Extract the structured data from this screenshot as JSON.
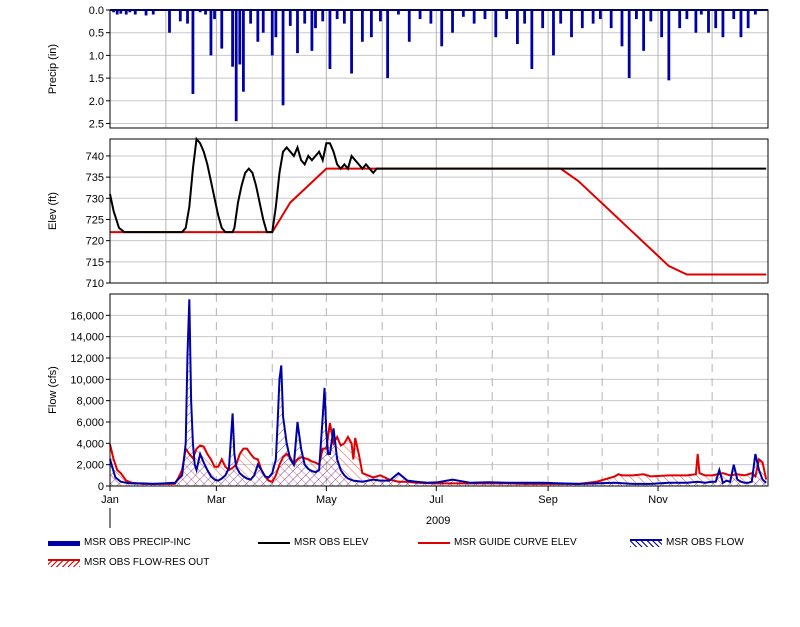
{
  "colors": {
    "precip": "#0000A8",
    "elev": "#000000",
    "guide": "#E00000",
    "flow": "#0000A8",
    "flow_res_out": "#E00000",
    "grid": "#C8C8C8",
    "month_grid": "#B4B4B4"
  },
  "chart_data": [
    {
      "type": "bar",
      "ylabel": "Precip (in)",
      "inverted_y": true,
      "ylim": [
        0,
        2.6
      ],
      "yticks": [
        0.0,
        0.5,
        1.0,
        1.5,
        2.0,
        2.5
      ],
      "ytick_labels": [
        "0.0",
        "0.5",
        "1.0",
        "1.5",
        "2.0",
        "2.5"
      ],
      "series": [
        {
          "name": "MSR OBS PRECIP-INC",
          "x_day": [
            2,
            4,
            6,
            9,
            11,
            14,
            20,
            24,
            33,
            39,
            43,
            46,
            50,
            53,
            56,
            58,
            62,
            68,
            70,
            72,
            74,
            78,
            82,
            85,
            90,
            92,
            96,
            100,
            104,
            108,
            112,
            114,
            118,
            122,
            126,
            130,
            134,
            140,
            145,
            150,
            154,
            160,
            166,
            172,
            178,
            184,
            190,
            196,
            202,
            208,
            214,
            220,
            226,
            230,
            234,
            240,
            246,
            250,
            256,
            262,
            268,
            272,
            278,
            284,
            288,
            292,
            296,
            300,
            306,
            310,
            316,
            320,
            325,
            328,
            332,
            336,
            340,
            346,
            350,
            354,
            358
          ],
          "values": [
            0.05,
            0.1,
            0.08,
            0.1,
            0.05,
            0.1,
            0.12,
            0.1,
            0.5,
            0.25,
            0.3,
            1.85,
            0.05,
            0.1,
            1.0,
            0.2,
            0.85,
            1.25,
            2.45,
            1.2,
            1.8,
            0.3,
            0.7,
            0.5,
            1.0,
            0.6,
            2.1,
            0.35,
            0.95,
            0.3,
            0.9,
            0.4,
            0.25,
            1.3,
            0.2,
            0.3,
            1.4,
            0.7,
            0.6,
            0.25,
            1.5,
            0.1,
            0.7,
            0.2,
            0.3,
            0.8,
            0.5,
            0.15,
            0.3,
            0.2,
            0.6,
            0.2,
            0.75,
            0.3,
            1.3,
            0.4,
            1.0,
            0.3,
            0.6,
            0.4,
            0.3,
            0.2,
            0.4,
            0.8,
            1.5,
            0.2,
            0.9,
            0.25,
            0.6,
            1.55,
            0.4,
            0.2,
            0.5,
            0.1,
            0.5,
            0.4,
            0.6,
            0.2,
            0.6,
            0.4,
            0.1
          ]
        }
      ]
    },
    {
      "type": "line",
      "ylabel": "Elev (ft)",
      "ylim": [
        710,
        744
      ],
      "yticks": [
        710,
        715,
        720,
        725,
        730,
        735,
        740
      ],
      "ytick_labels": [
        "710",
        "715",
        "720",
        "725",
        "730",
        "735",
        "740"
      ],
      "series": [
        {
          "name": "MSR OBS ELEV",
          "x_day": [
            0,
            2,
            5,
            8,
            20,
            30,
            35,
            40,
            42,
            44,
            46,
            48,
            50,
            52,
            54,
            56,
            58,
            60,
            62,
            64,
            66,
            68,
            69,
            71,
            73,
            75,
            77,
            79,
            81,
            83,
            85,
            87,
            88,
            90,
            92,
            94,
            96,
            98,
            100,
            102,
            104,
            106,
            108,
            110,
            112,
            114,
            116,
            118,
            120,
            122,
            124,
            126,
            128,
            130,
            132,
            134,
            136,
            138,
            140,
            142,
            144,
            146,
            148,
            150,
            155,
            160,
            170,
            180,
            190,
            200,
            210,
            220,
            230,
            240,
            250,
            255,
            258,
            260,
            263,
            266,
            268,
            270,
            272,
            274,
            278,
            282,
            286,
            290,
            294,
            298,
            302,
            306,
            310,
            314,
            318,
            322,
            326,
            328,
            330,
            332,
            334,
            336,
            338,
            340,
            342,
            344,
            346,
            348,
            350,
            352,
            354,
            355,
            356,
            357,
            358,
            360,
            362,
            364
          ],
          "values": [
            731,
            727,
            723,
            722,
            722,
            722,
            722,
            722,
            723,
            728,
            737,
            744,
            743,
            741,
            738,
            734,
            730,
            726,
            723,
            722,
            722,
            722,
            723,
            729,
            733,
            736,
            737,
            736,
            733,
            729,
            725,
            722,
            722,
            722,
            728,
            736,
            741,
            742,
            741,
            740,
            742,
            739,
            738,
            740,
            739,
            740,
            741,
            739,
            743,
            743,
            741,
            738,
            737,
            738,
            737,
            740,
            739,
            738,
            737,
            738,
            737,
            736,
            737,
            737,
            737,
            737,
            737,
            737,
            737,
            737,
            737,
            737,
            737,
            737,
            737,
            737,
            737,
            737,
            737,
            737,
            737,
            737,
            737,
            737,
            737,
            737,
            737,
            737,
            737,
            737,
            737,
            737,
            737,
            737,
            737,
            737,
            737,
            737,
            737,
            737,
            737,
            737,
            737,
            737,
            737,
            737,
            737,
            737,
            737,
            737,
            737,
            737,
            737,
            737,
            737,
            737,
            737,
            737,
            737
          ]
        },
        {
          "name": "MSR GUIDE CURVE ELEV",
          "x_day": [
            0,
            10,
            30,
            50,
            70,
            80,
            90,
            100,
            110,
            120,
            140,
            160,
            180,
            200,
            220,
            240,
            250,
            260,
            270,
            280,
            290,
            300,
            310,
            320,
            330,
            335,
            340,
            350,
            360,
            364
          ],
          "values": [
            722,
            722,
            722,
            722,
            722,
            722,
            722,
            729,
            733,
            737,
            737,
            737,
            737,
            737,
            737,
            737,
            737,
            734,
            730,
            726,
            722,
            718,
            714,
            712,
            712,
            712,
            712,
            712,
            712,
            712
          ]
        }
      ]
    },
    {
      "type": "area",
      "ylabel": "Flow (cfs)",
      "ylim": [
        0,
        18000
      ],
      "yticks": [
        0,
        2000,
        4000,
        6000,
        8000,
        10000,
        12000,
        14000,
        16000
      ],
      "ytick_labels": [
        "0",
        "2,000",
        "4,000",
        "6,000",
        "8,000",
        "10,000",
        "12,000",
        "14,000",
        "16,000"
      ],
      "series": [
        {
          "name": "MSR OBS FLOW",
          "x_day": [
            0,
            3,
            6,
            9,
            12,
            18,
            24,
            30,
            36,
            40,
            42,
            43,
            44,
            45,
            46,
            47,
            48,
            50,
            52,
            54,
            56,
            58,
            60,
            62,
            64,
            66,
            68,
            69,
            70,
            72,
            74,
            76,
            78,
            80,
            82,
            84,
            86,
            88,
            90,
            92,
            93,
            94,
            95,
            96,
            98,
            100,
            102,
            104,
            106,
            108,
            110,
            112,
            114,
            116,
            118,
            119,
            120,
            121,
            122,
            124,
            126,
            128,
            130,
            132,
            135,
            140,
            146,
            150,
            155,
            160,
            165,
            170,
            176,
            182,
            190,
            200,
            210,
            220,
            230,
            240,
            250,
            260,
            270,
            280,
            290,
            300,
            310,
            320,
            326,
            330,
            334,
            336,
            338,
            340,
            342,
            344,
            346,
            348,
            350,
            352,
            354,
            356,
            358,
            360,
            362,
            364
          ],
          "values": [
            2500,
            800,
            400,
            300,
            250,
            250,
            200,
            250,
            300,
            1000,
            4000,
            12400,
            17500,
            8000,
            4000,
            2000,
            1500,
            3000,
            2200,
            1500,
            900,
            600,
            500,
            700,
            1000,
            1700,
            6800,
            3000,
            1800,
            1200,
            900,
            700,
            600,
            1000,
            2000,
            1500,
            900,
            800,
            1200,
            2500,
            6000,
            10000,
            11300,
            6500,
            4000,
            2500,
            2000,
            6000,
            3500,
            2000,
            1600,
            1400,
            1300,
            1500,
            6500,
            9200,
            5000,
            3000,
            3000,
            5400,
            2500,
            1500,
            1000,
            700,
            500,
            400,
            600,
            500,
            500,
            1200,
            500,
            400,
            300,
            350,
            600,
            300,
            350,
            300,
            300,
            300,
            250,
            200,
            250,
            300,
            200,
            200,
            300,
            300,
            400,
            300,
            400,
            400,
            1500,
            300,
            500,
            400,
            2000,
            600,
            400,
            300,
            300,
            400,
            3000,
            1500,
            600,
            300
          ]
        },
        {
          "name": "MSR OBS FLOW-RES OUT",
          "x_day": [
            0,
            2,
            4,
            6,
            9,
            12,
            18,
            24,
            30,
            36,
            38,
            40,
            42,
            44,
            46,
            48,
            50,
            52,
            54,
            56,
            58,
            60,
            62,
            64,
            66,
            68,
            70,
            72,
            74,
            76,
            78,
            80,
            82,
            84,
            86,
            88,
            90,
            92,
            94,
            96,
            98,
            100,
            102,
            104,
            106,
            108,
            110,
            112,
            114,
            116,
            118,
            120,
            122,
            124,
            126,
            128,
            130,
            132,
            134,
            135,
            136,
            138,
            140,
            146,
            150,
            155,
            160,
            165,
            170,
            180,
            190,
            200,
            210,
            220,
            230,
            240,
            250,
            260,
            270,
            280,
            282,
            284,
            290,
            296,
            300,
            310,
            320,
            325,
            326,
            327,
            330,
            334,
            340,
            344,
            348,
            352,
            356,
            358,
            360,
            362,
            364
          ],
          "values": [
            3900,
            2500,
            1500,
            1200,
            500,
            300,
            200,
            200,
            200,
            200,
            800,
            1500,
            3500,
            3000,
            2600,
            3500,
            3800,
            3700,
            3000,
            2500,
            1800,
            1800,
            2500,
            1800,
            1500,
            1700,
            2000,
            3000,
            3500,
            3500,
            3000,
            2600,
            2500,
            1500,
            900,
            500,
            400,
            1000,
            2000,
            2700,
            3000,
            2700,
            2000,
            2500,
            2700,
            2600,
            2500,
            2300,
            2200,
            2000,
            3500,
            3500,
            5900,
            4000,
            4600,
            3800,
            4000,
            4600,
            4000,
            2500,
            4500,
            3000,
            1200,
            800,
            1000,
            600,
            400,
            400,
            300,
            250,
            250,
            250,
            250,
            250,
            200,
            200,
            200,
            200,
            400,
            900,
            1100,
            1000,
            1000,
            1100,
            900,
            1000,
            1000,
            1100,
            3000,
            1200,
            1000,
            1000,
            1200,
            1000,
            1100,
            1000,
            1200,
            900,
            2500,
            2200,
            600
          ]
        }
      ]
    }
  ],
  "x_axis": {
    "year_label": "2009",
    "month_labels": [
      "Jan",
      "Mar",
      "May",
      "Jul",
      "Sep",
      "Nov"
    ],
    "month_label_days": [
      0,
      59,
      120,
      181,
      243,
      304
    ],
    "month_grid_days": [
      31,
      59,
      90,
      120,
      151,
      181,
      212,
      243,
      273,
      304,
      334
    ],
    "days_in_year": 365
  },
  "legend": {
    "items": [
      {
        "label": "MSR OBS PRECIP-INC",
        "style": "thick"
      },
      {
        "label": "MSR OBS ELEV",
        "style": "line-black"
      },
      {
        "label": "MSR GUIDE CURVE ELEV",
        "style": "line-red"
      },
      {
        "label": "MSR OBS FLOW",
        "style": "hatch-blue"
      },
      {
        "label": "MSR OBS FLOW-RES OUT",
        "style": "hatch-red"
      }
    ]
  }
}
